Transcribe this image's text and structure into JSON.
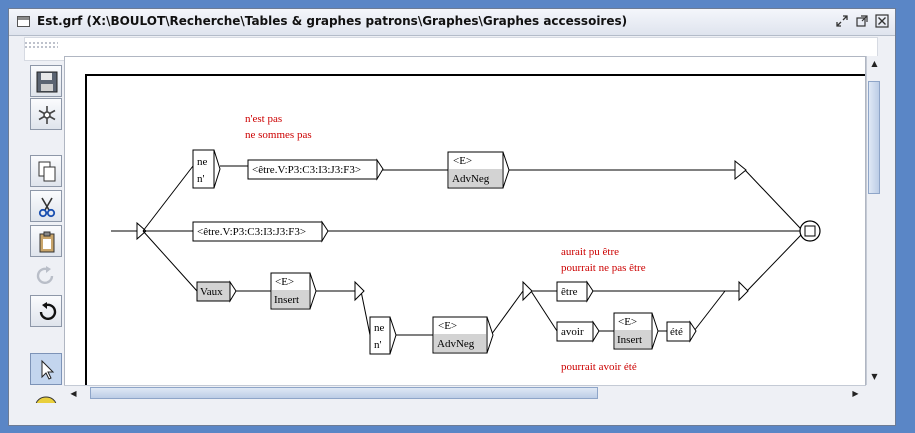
{
  "window": {
    "title": "Est.grf (X:\\BOULOT\\Recherche\\Tables & graphes patrons\\Graphes\\Graphes accessoires)"
  },
  "toolbar": {
    "tools": [
      {
        "name": "save-tool",
        "icon": "floppy-disk-icon"
      },
      {
        "name": "compile-tool",
        "icon": "snowflake-icon"
      },
      {
        "name": "copy-tool",
        "icon": "copy-icon"
      },
      {
        "name": "cut-tool",
        "icon": "scissors-icon"
      },
      {
        "name": "paste-tool",
        "icon": "clipboard-icon"
      },
      {
        "name": "redo-tool",
        "icon": "redo-icon"
      },
      {
        "name": "undo-tool",
        "icon": "undo-icon"
      },
      {
        "name": "select-tool",
        "icon": "pointer-icon"
      }
    ]
  },
  "graph": {
    "comments": {
      "top_1": "n'est pas",
      "top_2": "ne sommes pas",
      "right_1": "aurait pu être",
      "right_2": "pourrait ne pas être",
      "bottom": "pourrait avoir été"
    },
    "boxes": {
      "ne": "ne",
      "n_apos": "n'",
      "etre_upper": "<être.V:P3:C3:I3:J3:F3>",
      "adv_neg_tag": "<E>",
      "adv_neg_output": "AdvNeg",
      "etre_middle": "<être.V:P3:C3:I3:J3:F3>",
      "vaux": "Vaux",
      "insert_tag": "<E>",
      "insert_output": "Insert",
      "ne2": "ne",
      "n_apos2": "n'",
      "adv_neg2_tag": "<E>",
      "adv_neg2_output": "AdvNeg",
      "etre_right": "être",
      "avoir": "avoir",
      "insert2_tag": "<E>",
      "insert2_output": "Insert",
      "ete": "été"
    },
    "comment_color": "#cc0000",
    "line_color": "#000000",
    "output_fill": "#d3d3d3"
  }
}
